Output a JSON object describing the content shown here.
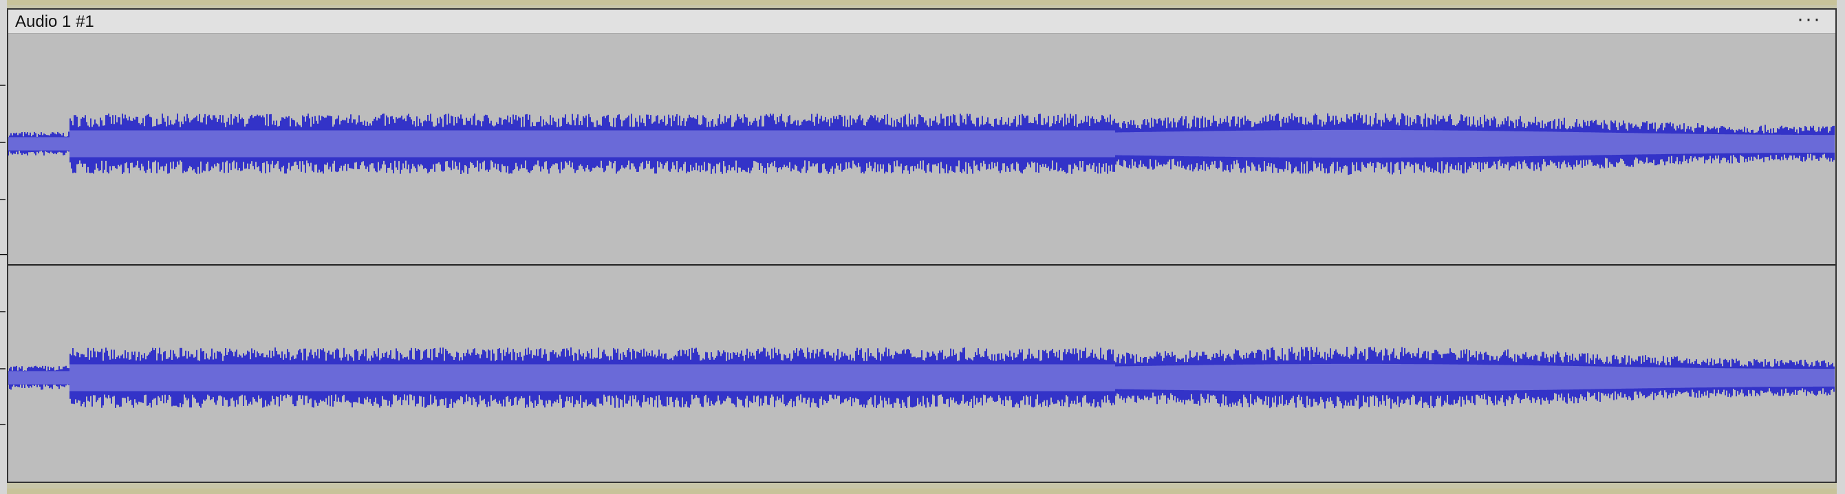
{
  "clip": {
    "name": "Audio 1 #1",
    "menu_label": "···"
  },
  "colors": {
    "waveform_peak": "#3333c8",
    "waveform_rms": "#6a6ad8",
    "clip_background": "#bdbdbd",
    "header_background": "#e1e1e1",
    "track_border": "#c8c39a"
  },
  "channels": [
    "left-channel",
    "right-channel"
  ]
}
